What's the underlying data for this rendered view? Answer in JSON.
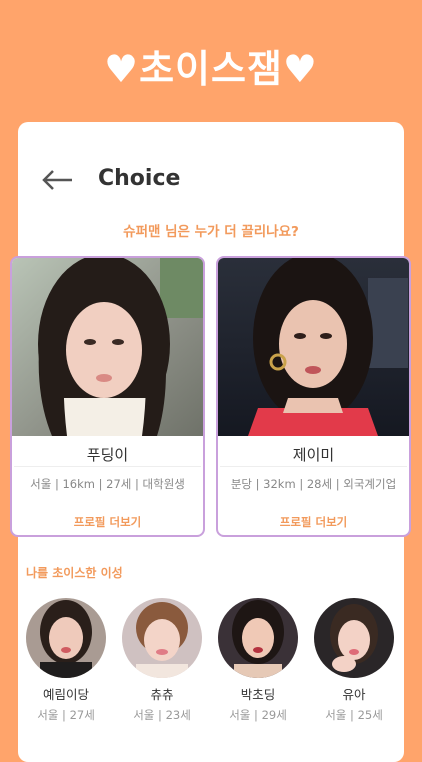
{
  "banner": {
    "title": "♥초이스잼♥"
  },
  "header": {
    "title": "Choice",
    "back_icon": "arrow-left-icon"
  },
  "question": "슈퍼맨 님은 누가 더 끌리나요?",
  "profiles": [
    {
      "name": "푸딩이",
      "info": "서울 | 16km | 27세 | 대학원생",
      "more": "프로필 더보기"
    },
    {
      "name": "제이미",
      "info": "분당 | 32km | 28세 | 외국계기업",
      "more": "프로필 더보기"
    }
  ],
  "chosen": {
    "title": "나를 초이스한 이성",
    "people": [
      {
        "name": "예림이당",
        "info": "서울 | 27세"
      },
      {
        "name": "츄츄",
        "info": "서울 | 23세"
      },
      {
        "name": "박초딩",
        "info": "서울 | 29세"
      },
      {
        "name": "유아",
        "info": "서울 | 25세"
      }
    ]
  },
  "colors": {
    "background": "#FFA46B",
    "accent": "#F29A5C",
    "card_border": "#C9A0DC"
  }
}
